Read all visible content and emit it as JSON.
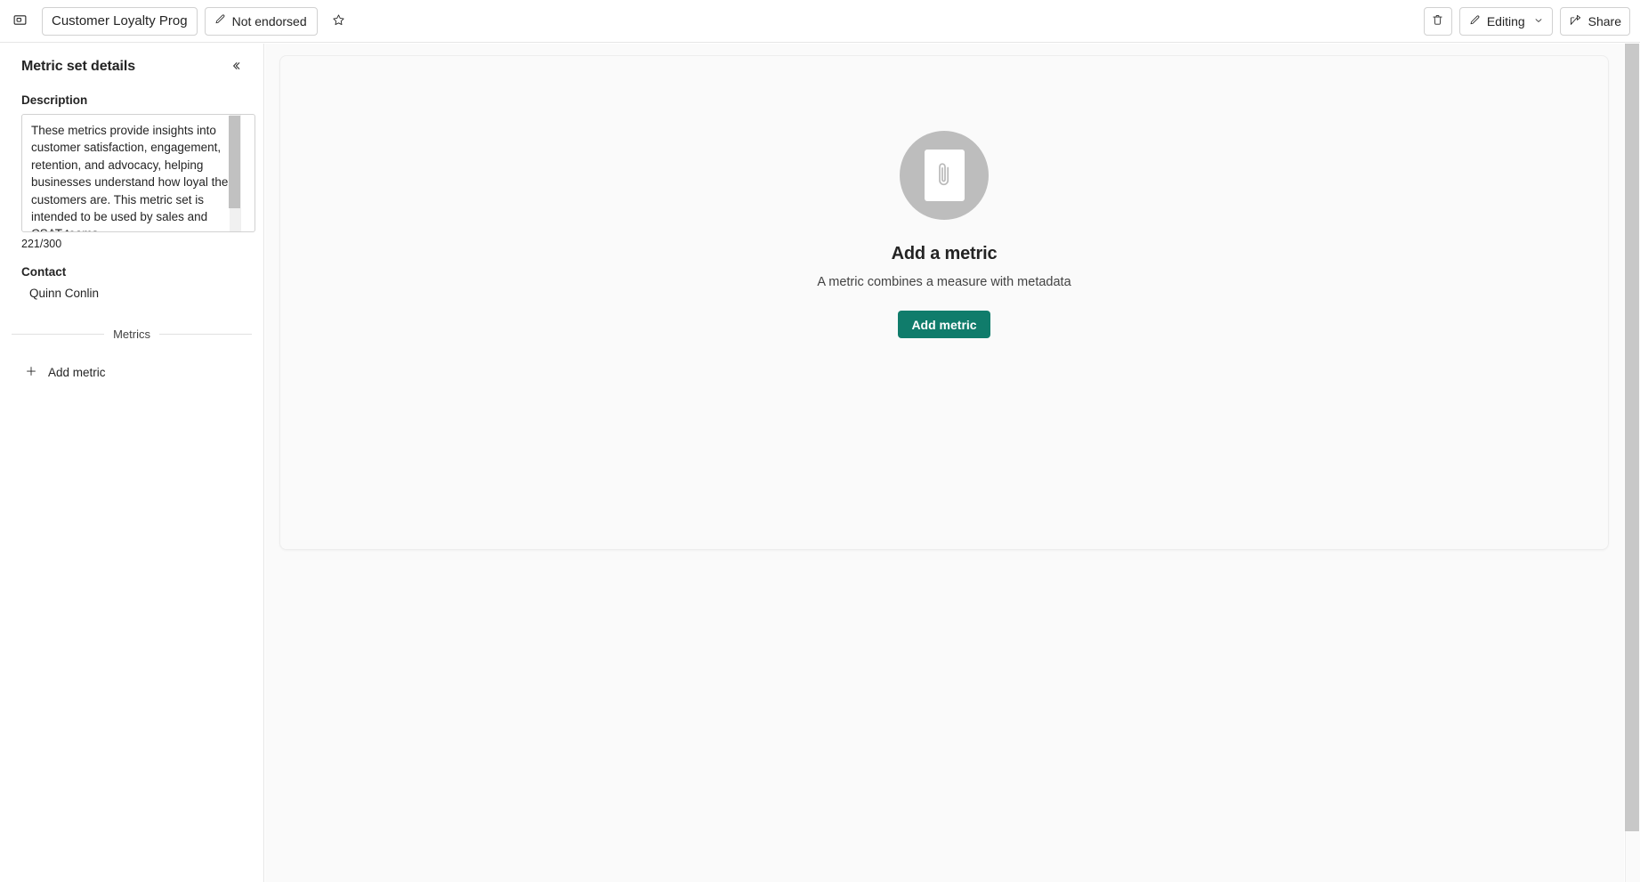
{
  "topbar": {
    "panel_toggle_icon": "panel-toggle-icon",
    "title_value": "Customer Loyalty Prog",
    "title_placeholder": "Name",
    "endorsement_label": "Not endorsed",
    "endorsement_icon": "pencil-icon",
    "favorite_icon": "star-icon",
    "delete_icon": "trash-icon",
    "mode_label": "Editing",
    "mode_icon": "pencil-icon",
    "mode_caret_icon": "chevron-down-icon",
    "share_label": "Share",
    "share_icon": "share-icon"
  },
  "sidebar": {
    "title": "Metric set details",
    "collapse_icon": "chevron-double-left-icon",
    "description_label": "Description",
    "description_value": "These metrics provide insights into customer satisfaction, engagement, retention, and advocacy, helping businesses understand how loyal their customers are.  This metric set is intended to be used by sales and CSAT teams.",
    "description_placeholder": "Add a description",
    "char_count": "221/300",
    "contact_label": "Contact",
    "contact_value": "Quinn Conlin",
    "metrics_divider_label": "Metrics",
    "add_metric_label": "Add metric",
    "add_metric_icon": "plus-icon"
  },
  "main": {
    "empty_state": {
      "illustration_icon": "paperclip-document-icon",
      "title": "Add a metric",
      "subtitle": "A metric combines a measure with metadata",
      "button_label": "Add metric"
    }
  },
  "colors": {
    "accent_green": "#107c6b",
    "border": "#d1d1d1",
    "canvas": "#fafafa",
    "illustration_gray": "#bdbdbd"
  }
}
